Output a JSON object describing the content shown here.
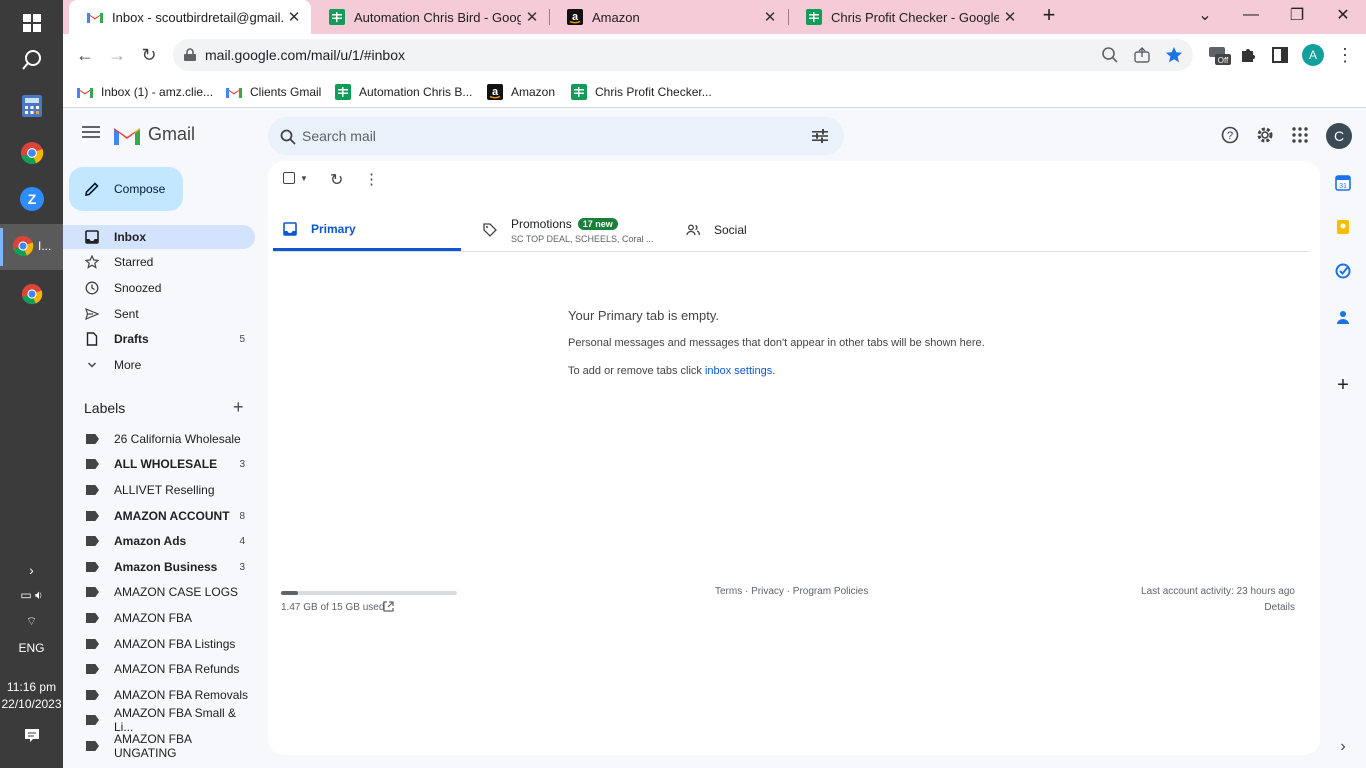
{
  "taskbar": {
    "running_app_label": "I...",
    "language": "ENG",
    "time": "11:16 pm",
    "date": "22/10/2023"
  },
  "browser": {
    "tabs": [
      {
        "title": "Inbox - scoutbirdretail@gmail.com",
        "icon": "gmail-icon",
        "active": true
      },
      {
        "title": "Automation Chris Bird - Google",
        "icon": "sheets-icon",
        "active": false
      },
      {
        "title": "Amazon",
        "icon": "amazon-icon",
        "active": false
      },
      {
        "title": "Chris Profit Checker - Google Sh",
        "icon": "sheets-icon",
        "active": false
      }
    ],
    "url": "mail.google.com/mail/u/1/#inbox",
    "profile_initial": "A",
    "extension_badge": "Off",
    "bookmarks": [
      {
        "label": "Inbox (1) - amz.clie...",
        "icon": "gmail-icon"
      },
      {
        "label": "Clients Gmail",
        "icon": "gmail-icon"
      },
      {
        "label": "Automation Chris B...",
        "icon": "sheets-icon"
      },
      {
        "label": "Amazon",
        "icon": "amazon-icon"
      },
      {
        "label": "Chris Profit Checker...",
        "icon": "sheets-icon"
      }
    ]
  },
  "gmail": {
    "brand": "Gmail",
    "search_placeholder": "Search mail",
    "account_initial": "C",
    "compose_label": "Compose",
    "nav": [
      {
        "label": "Inbox",
        "icon": "inbox-icon",
        "count": "",
        "selected": true,
        "bold": true
      },
      {
        "label": "Starred",
        "icon": "star-icon",
        "count": "",
        "selected": false,
        "bold": false
      },
      {
        "label": "Snoozed",
        "icon": "clock-icon",
        "count": "",
        "selected": false,
        "bold": false
      },
      {
        "label": "Sent",
        "icon": "send-icon",
        "count": "",
        "selected": false,
        "bold": false
      },
      {
        "label": "Drafts",
        "icon": "draft-icon",
        "count": "5",
        "selected": false,
        "bold": true
      },
      {
        "label": "More",
        "icon": "chevron-down-icon",
        "count": "",
        "selected": false,
        "bold": false
      }
    ],
    "labels_heading": "Labels",
    "labels": [
      {
        "label": "26 California Wholesale",
        "count": "",
        "bold": false
      },
      {
        "label": "ALL WHOLESALE",
        "count": "3",
        "bold": true
      },
      {
        "label": "ALLIVET Reselling",
        "count": "",
        "bold": false
      },
      {
        "label": "AMAZON ACCOUNT",
        "count": "8",
        "bold": true
      },
      {
        "label": "Amazon Ads",
        "count": "4",
        "bold": true
      },
      {
        "label": "Amazon Business",
        "count": "3",
        "bold": true
      },
      {
        "label": "AMAZON CASE LOGS",
        "count": "",
        "bold": false
      },
      {
        "label": "AMAZON FBA",
        "count": "",
        "bold": false
      },
      {
        "label": "AMAZON FBA Listings",
        "count": "",
        "bold": false
      },
      {
        "label": "AMAZON FBA Refunds",
        "count": "",
        "bold": false
      },
      {
        "label": "AMAZON FBA Removals",
        "count": "",
        "bold": false
      },
      {
        "label": "AMAZON FBA Small & Li...",
        "count": "",
        "bold": false
      },
      {
        "label": "AMAZON FBA UNGATING",
        "count": "",
        "bold": false
      }
    ],
    "tabs": {
      "primary": "Primary",
      "promotions": "Promotions",
      "promotions_badge": "17 new",
      "promotions_snippet": "SC TOP DEAL, SCHEELS, Coral ...",
      "social": "Social"
    },
    "empty_title": "Your Primary tab is empty.",
    "empty_desc": "Personal messages and messages that don't appear in other tabs will be shown here.",
    "empty_hint_prefix": "To add or remove tabs click ",
    "empty_hint_link": "inbox settings",
    "empty_hint_suffix": ".",
    "storage_text": "1.47 GB of 15 GB used",
    "storage_fraction": 0.098,
    "footer_links": "Terms · Privacy · Program Policies",
    "last_activity": "Last account activity: 23 hours ago",
    "details_link": "Details"
  },
  "colors": {
    "tab_strip": "#f4cbd6",
    "accent_blue": "#0b57d0",
    "compose_bg": "#c2e7ff",
    "selected_nav": "#d3e3fd",
    "badge_green": "#188038"
  }
}
